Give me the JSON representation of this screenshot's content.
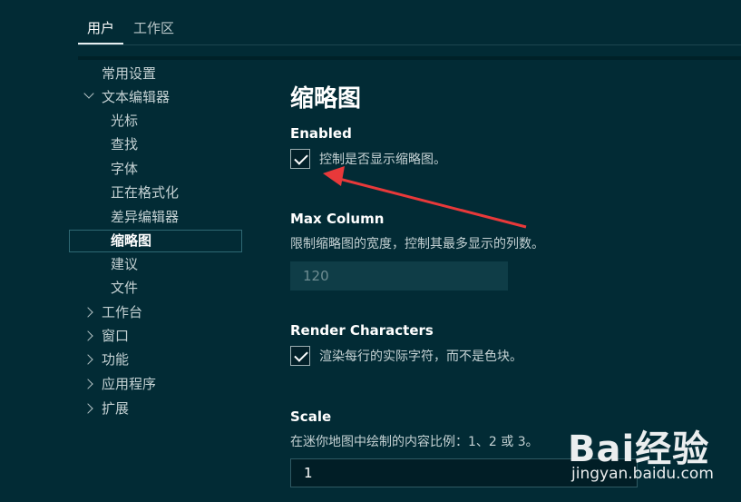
{
  "tabs": {
    "user": "用户",
    "workspace": "工作区"
  },
  "toc": {
    "common": "常用设置",
    "text_editor": "文本编辑器",
    "cursor": "光标",
    "find": "查找",
    "font": "字体",
    "formatting": "正在格式化",
    "diff_editor": "差异编辑器",
    "minimap": "缩略图",
    "suggestions": "建议",
    "files": "文件",
    "workbench": "工作台",
    "window": "窗口",
    "features": "功能",
    "application": "应用程序",
    "extensions": "扩展"
  },
  "content": {
    "section_title": "缩略图",
    "enabled": {
      "title": "Enabled",
      "desc": "控制是否显示缩略图。",
      "checked": true
    },
    "max_column": {
      "title": "Max Column",
      "desc": "限制缩略图的宽度，控制其最多显示的列数。",
      "value": "120"
    },
    "render_characters": {
      "title": "Render Characters",
      "desc": "渲染每行的实际字符，而不是色块。",
      "checked": true
    },
    "scale": {
      "title": "Scale",
      "desc": "在迷你地图中绘制的内容比例：1、2 或 3。",
      "value": "1"
    }
  },
  "colors": {
    "background": "#022b35",
    "arrow": "#e8393a",
    "selection_border": "#2e6873"
  },
  "watermark": {
    "brand": "Bai经验",
    "url": "jingyan.baidu.com"
  }
}
